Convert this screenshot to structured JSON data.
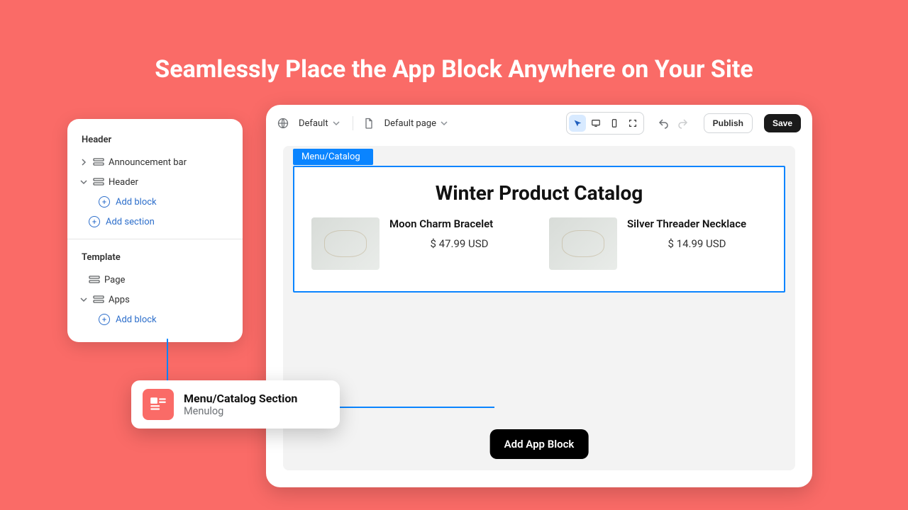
{
  "hero_title": "Seamlessly Place the App Block Anywhere on Your Site",
  "sidebar": {
    "group1_label": "Header",
    "announcement_bar": "Announcement bar",
    "header_item": "Header",
    "add_block": "Add block",
    "add_section": "Add section",
    "group2_label": "Template",
    "page_item": "Page",
    "apps_item": "Apps"
  },
  "topbar": {
    "theme": "Default",
    "page": "Default page",
    "publish": "Publish",
    "save": "Save"
  },
  "canvas": {
    "tab_label": "Menu/Catalog",
    "heading": "Winter Product Catalog",
    "products": [
      {
        "name": "Moon Charm Bracelet",
        "price": "$ 47.99 USD"
      },
      {
        "name": "Silver Threader Necklace",
        "price": "$ 14.99 USD"
      }
    ],
    "add_app_block": "Add App Block"
  },
  "popover": {
    "title": "Menu/Catalog Section",
    "subtitle": "Menulog"
  }
}
